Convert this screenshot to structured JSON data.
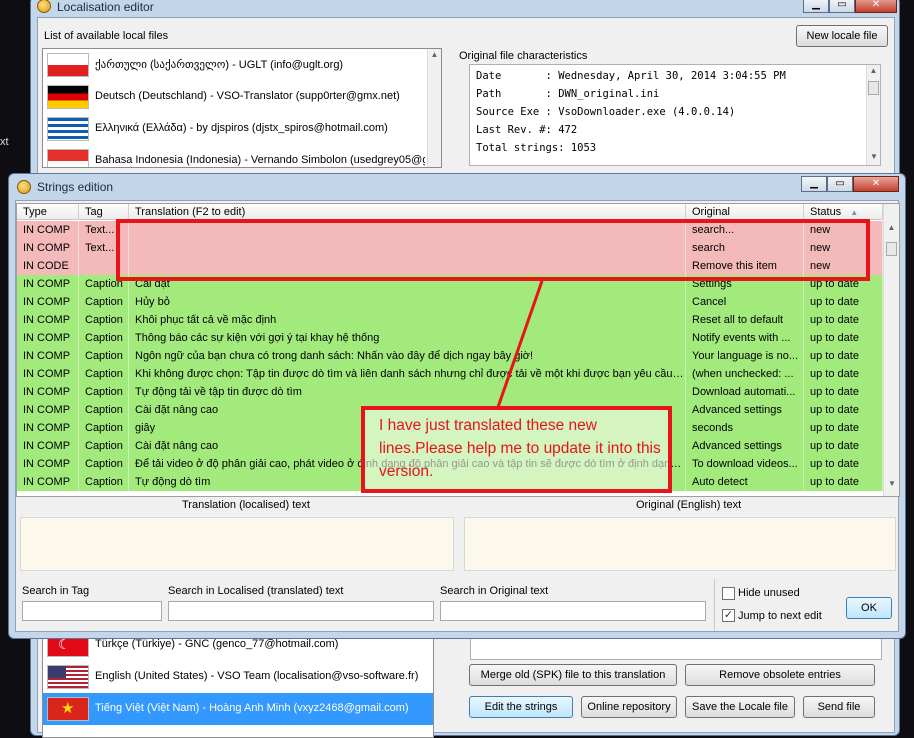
{
  "edge_text": "xt",
  "loc_editor": {
    "title": "Localisation editor",
    "list_label": "List of available local files",
    "new_locale_button": "New locale file",
    "orig_label": "Original file characteristics",
    "languages": [
      {
        "name": "ქართული (საქართველო) - UGLT (info@uglt.org)",
        "flag": "georgia"
      },
      {
        "name": "Deutsch (Deutschland) - VSO-Translator (supp0rter@gmx.net)",
        "flag": "germany"
      },
      {
        "name": "Ελληνικά (Ελλάδα) - by djspiros (djstx_spiros@hotmail.com)",
        "flag": "greece"
      },
      {
        "name": "Bahasa Indonesia (Indonesia) - Vernando Simbolon (usedgrey05@gi",
        "flag": "indonesia"
      }
    ],
    "characteristics": [
      {
        "key": "Date       ",
        "value": "Wednesday, April 30, 2014 3:04:55 PM"
      },
      {
        "key": "Path       ",
        "value": "DWN_original.ini"
      },
      {
        "key": "Source Exe ",
        "value": "VsoDownloader.exe (4.0.0.14)"
      },
      {
        "key": "Last Rev. #",
        "value": "472"
      },
      {
        "key": "Total strings",
        "value": "1053"
      }
    ],
    "lower_languages": [
      {
        "name": "Türkçe (Türkiye) - GNC (genco_77@hotmail.com)",
        "flag": "turkey",
        "selected": false
      },
      {
        "name": "English (United States) - VSO Team (localisation@vso-software.fr)",
        "flag": "usa",
        "selected": false
      },
      {
        "name": "Tiếng Việt (Việt Nam) - Hoàng Anh Minh (vxyz2468@gmail.com)",
        "flag": "vietnam",
        "selected": true
      }
    ],
    "merge_button": "Merge old (SPK) file to this translation",
    "remove_obsolete_button": "Remove obsolete entries",
    "edit_strings_button": "Edit the strings",
    "online_repo_button": "Online repository",
    "save_button": "Save the Locale file",
    "send_button": "Send file"
  },
  "strings_editor": {
    "title": "Strings edition",
    "columns": {
      "type": "Type",
      "tag": "Tag",
      "translation": "Translation (F2 to edit)",
      "original": "Original",
      "status": "Status"
    },
    "rows": [
      {
        "type": "IN COMP",
        "tag": "Text...",
        "translation": "",
        "original": "search...",
        "status": "new",
        "state": "new"
      },
      {
        "type": "IN COMP",
        "tag": "Text...",
        "translation": "",
        "original": "search",
        "status": "new",
        "state": "new"
      },
      {
        "type": "IN CODE",
        "tag": "",
        "translation": "",
        "original": "Remove this item",
        "status": "new",
        "state": "new"
      },
      {
        "type": "IN COMP",
        "tag": "Caption",
        "translation": "Cài đặt",
        "original": "Settings",
        "status": "up to date",
        "state": "ok"
      },
      {
        "type": "IN COMP",
        "tag": "Caption",
        "translation": "Hủy bỏ",
        "original": "Cancel",
        "status": "up to date",
        "state": "ok"
      },
      {
        "type": "IN COMP",
        "tag": "Caption",
        "translation": "Khôi phục tất cả về mặc định",
        "original": "Reset all to default",
        "status": "up to date",
        "state": "ok"
      },
      {
        "type": "IN COMP",
        "tag": "Caption",
        "translation": "Thông báo các sự kiện với gợi ý tại khay hệ thống",
        "original": "Notify events with ...",
        "status": "up to date",
        "state": "ok"
      },
      {
        "type": "IN COMP",
        "tag": "Caption",
        "translation": "Ngôn ngữ của bạn chưa có trong danh sách: Nhấn vào đây để dịch ngay bây giờ!",
        "original": "Your language is no...",
        "status": "up to date",
        "state": "ok"
      },
      {
        "type": "IN COMP",
        "tag": "Caption",
        "translation": "Khi không được chọn: Tập tin được dò tìm và liên danh sách nhưng chỉ được tải về một khi được bạn yêu cầu – ...",
        "original": "(when unchecked: ...",
        "status": "up to date",
        "state": "ok"
      },
      {
        "type": "IN COMP",
        "tag": "Caption",
        "translation": "Tự động tải về tập tin được dò tìm",
        "original": "Download automati...",
        "status": "up to date",
        "state": "ok"
      },
      {
        "type": "IN COMP",
        "tag": "Caption",
        "translation": "Cài đặt nâng cao",
        "original": "Advanced settings",
        "status": "up to date",
        "state": "ok"
      },
      {
        "type": "IN COMP",
        "tag": "Caption",
        "translation": "giây",
        "original": "seconds",
        "status": "up to date",
        "state": "ok"
      },
      {
        "type": "IN COMP",
        "tag": "Caption",
        "translation": "Cài đặt nâng cao",
        "original": "Advanced settings",
        "status": "up to date",
        "state": "ok"
      },
      {
        "type": "IN COMP",
        "tag": "Caption",
        "translation": "Để tải video ở độ phân giải cao, phát video ở định dạng độ phân giải cao và tập tin sẽ được dò tìm ở định dạng...",
        "original": "To download videos...",
        "status": "up to date",
        "state": "ok"
      },
      {
        "type": "IN COMP",
        "tag": "Caption",
        "translation": "Tự động dò tìm",
        "original": "Auto detect",
        "status": "up to date",
        "state": "ok"
      }
    ],
    "translation_panel_label": "Translation (localised) text",
    "original_panel_label": "Original (English) text",
    "search_tag_label": "Search in Tag",
    "search_localised_label": "Search in Localised (translated) text",
    "search_original_label": "Search in Original text",
    "hide_unused_label": "Hide unused",
    "hide_unused_checked": false,
    "jump_next_label": "Jump to next edit",
    "jump_next_checked": true,
    "ok_button": "OK"
  },
  "annotation": {
    "note": "I have just translated these new lines.Please help me to update it into this version."
  },
  "colors": {
    "annotation_red": "#e8131b",
    "row_new": "#f4b9b9",
    "row_ok": "#a2ea7c"
  }
}
